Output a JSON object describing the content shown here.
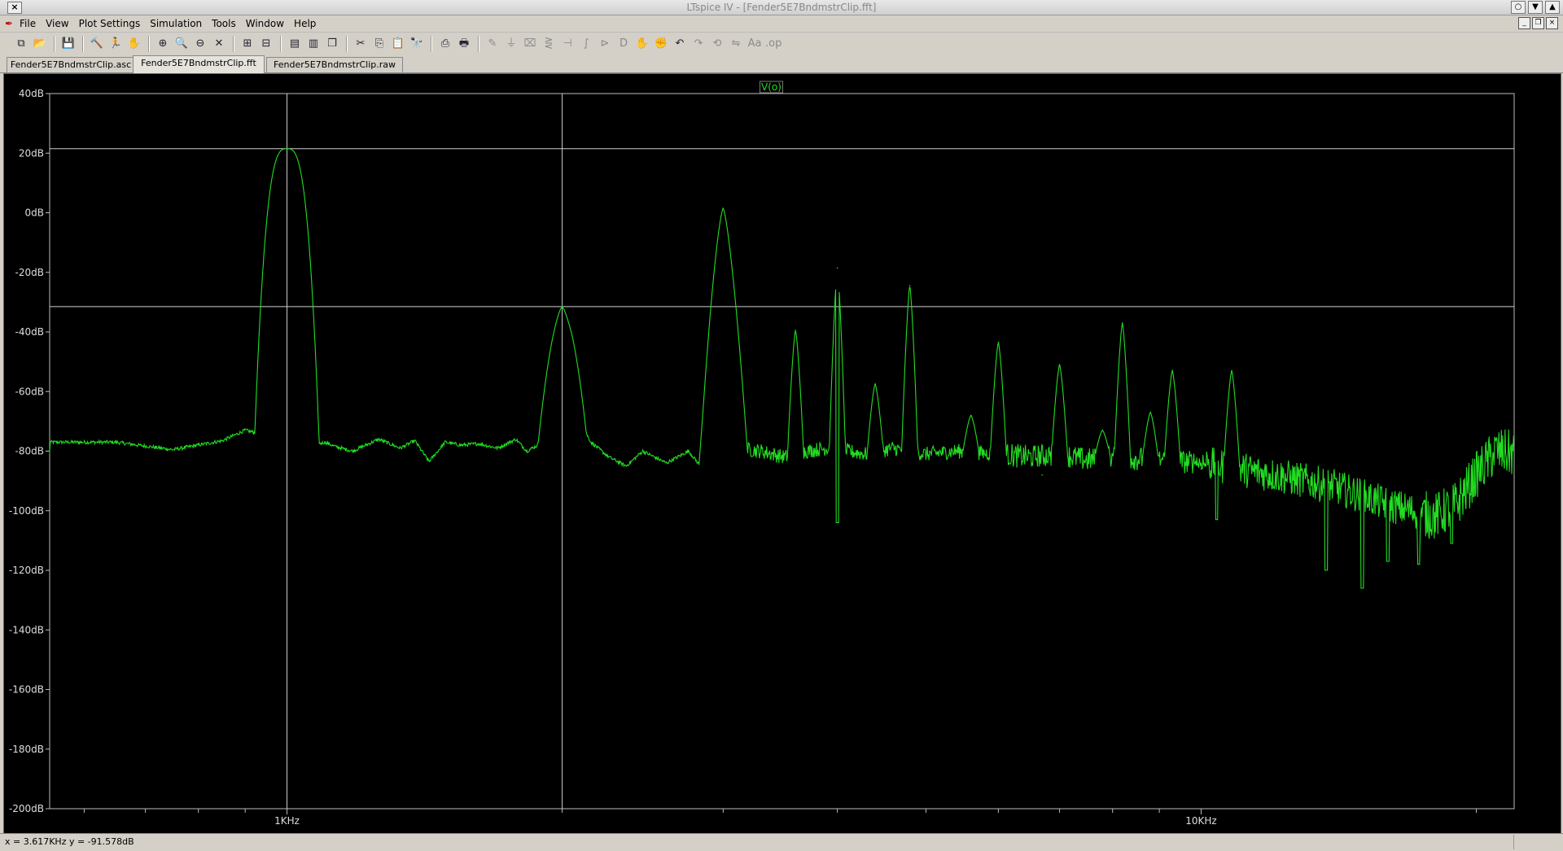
{
  "window": {
    "title": "LTspice IV - [Fender5E7BndmstrClip.fft]"
  },
  "menu": [
    "File",
    "View",
    "Plot Settings",
    "Simulation",
    "Tools",
    "Window",
    "Help"
  ],
  "toolbar": [
    {
      "name": "new-schematic",
      "glyph": "⧉"
    },
    {
      "name": "open",
      "glyph": "📂"
    },
    {
      "sep": true
    },
    {
      "name": "save",
      "glyph": "💾"
    },
    {
      "sep": true
    },
    {
      "name": "control-panel",
      "glyph": "🔨"
    },
    {
      "name": "run",
      "glyph": "🏃"
    },
    {
      "name": "pan",
      "glyph": "✋"
    },
    {
      "sep": true
    },
    {
      "name": "zoom-in",
      "glyph": "⊕"
    },
    {
      "name": "zoom-area",
      "glyph": "🔍"
    },
    {
      "name": "zoom-out",
      "glyph": "⊖"
    },
    {
      "name": "zoom-fit",
      "glyph": "✕"
    },
    {
      "sep": true
    },
    {
      "name": "autorange",
      "glyph": "⊞"
    },
    {
      "name": "autorange-y",
      "glyph": "⊟"
    },
    {
      "sep": true
    },
    {
      "name": "tile-horizontal",
      "glyph": "▤"
    },
    {
      "name": "tile-vertical",
      "glyph": "▥"
    },
    {
      "name": "cascade",
      "glyph": "❐"
    },
    {
      "sep": true
    },
    {
      "name": "cut",
      "glyph": "✂"
    },
    {
      "name": "copy",
      "glyph": "⎘"
    },
    {
      "name": "paste",
      "glyph": "📋"
    },
    {
      "name": "find",
      "glyph": "🔭"
    },
    {
      "sep": true
    },
    {
      "name": "print-preview",
      "glyph": "⎙"
    },
    {
      "name": "print",
      "glyph": "🖶"
    },
    {
      "sep": true
    },
    {
      "name": "draw-wire",
      "glyph": "✎",
      "dim": true
    },
    {
      "name": "ground",
      "glyph": "⏚",
      "dim": true
    },
    {
      "name": "label-net",
      "glyph": "⌧",
      "dim": true
    },
    {
      "name": "resistor",
      "glyph": "⋛",
      "dim": true
    },
    {
      "name": "capacitor",
      "glyph": "⊣",
      "dim": true
    },
    {
      "name": "inductor",
      "glyph": "∫",
      "dim": true
    },
    {
      "name": "diode",
      "glyph": "⊳",
      "dim": true
    },
    {
      "name": "component",
      "glyph": "D",
      "dim": true
    },
    {
      "name": "move",
      "glyph": "✋",
      "dim": true
    },
    {
      "name": "drag",
      "glyph": "✊",
      "dim": true
    },
    {
      "name": "undo",
      "glyph": "↶"
    },
    {
      "name": "redo",
      "glyph": "↷",
      "dim": true
    },
    {
      "name": "rotate",
      "glyph": "⟲",
      "dim": true
    },
    {
      "name": "mirror",
      "glyph": "⇋",
      "dim": true
    },
    {
      "name": "text",
      "glyph": "Aa",
      "dim": true
    },
    {
      "name": "spice-directive",
      "glyph": ".op",
      "dim": true
    }
  ],
  "tabs": [
    {
      "label": "Fender5E7BndmstrClip.asc",
      "active": false
    },
    {
      "label": "Fender5E7BndmstrClip.fft",
      "active": true
    },
    {
      "label": "Fender5E7BndmstrClip.raw",
      "active": false
    }
  ],
  "chart_data": {
    "type": "line",
    "trace_label": "V(o)",
    "trace_color": "#22dd22",
    "x_scale": "log",
    "x_range_hz": [
      550,
      22000
    ],
    "x_tick_labels": [
      {
        "value": 1000,
        "label": "1KHz"
      },
      {
        "value": 10000,
        "label": "10KHz"
      }
    ],
    "ylim": [
      -200,
      40
    ],
    "y_tick_labels": [
      "40dB",
      "20dB",
      "0dB",
      "-20dB",
      "-40dB",
      "-60dB",
      "-80dB",
      "-100dB",
      "-120dB",
      "-140dB",
      "-160dB",
      "-180dB",
      "-200dB"
    ],
    "cursors": [
      {
        "x": 1000,
        "y": 21.5
      },
      {
        "x": 2000,
        "y": -31.5
      }
    ],
    "baseline": [
      [
        550,
        -77
      ],
      [
        650,
        -77
      ],
      [
        750,
        -79.5
      ],
      [
        850,
        -76.5
      ],
      [
        900,
        -73
      ],
      [
        960,
        -75
      ],
      [
        1030,
        -79.5
      ],
      [
        1100,
        -77
      ],
      [
        1130,
        -78.5
      ],
      [
        1180,
        -80
      ],
      [
        1260,
        -76
      ],
      [
        1330,
        -79
      ],
      [
        1380,
        -76.5
      ],
      [
        1430,
        -83.5
      ],
      [
        1490,
        -77
      ],
      [
        1550,
        -78
      ],
      [
        1620,
        -77.5
      ],
      [
        1700,
        -79
      ],
      [
        1780,
        -76
      ],
      [
        1830,
        -80
      ],
      [
        1880,
        -78
      ],
      [
        1950,
        -70
      ],
      [
        2050,
        -65
      ],
      [
        2150,
        -77
      ],
      [
        2250,
        -82
      ],
      [
        2350,
        -85
      ],
      [
        2450,
        -80
      ],
      [
        2600,
        -84
      ],
      [
        2750,
        -80
      ],
      [
        2850,
        -86
      ],
      [
        2950,
        -82
      ],
      [
        3100,
        -79
      ],
      [
        3300,
        -80
      ],
      [
        3500,
        -82
      ],
      [
        3700,
        -80
      ],
      [
        3900,
        -79
      ],
      [
        4100,
        -80
      ],
      [
        4300,
        -81
      ],
      [
        4600,
        -79
      ],
      [
        5000,
        -81
      ],
      [
        5400,
        -80
      ],
      [
        6000,
        -81
      ],
      [
        6500,
        -82
      ],
      [
        7000,
        -81
      ],
      [
        7500,
        -83
      ],
      [
        8000,
        -82
      ],
      [
        9000,
        -83
      ],
      [
        10000,
        -84
      ],
      [
        11000,
        -86
      ],
      [
        12000,
        -88
      ],
      [
        13000,
        -90
      ],
      [
        14000,
        -92
      ],
      [
        15000,
        -95
      ],
      [
        16000,
        -98
      ],
      [
        17000,
        -100
      ],
      [
        18000,
        -102
      ],
      [
        19000,
        -98
      ],
      [
        20000,
        -88
      ],
      [
        21000,
        -80
      ],
      [
        22000,
        -81
      ]
    ],
    "peaks": [
      {
        "x": 1000,
        "y": 21.5
      },
      {
        "x": 2000,
        "y": -31.5
      },
      {
        "x": 3000,
        "y": 1.5
      },
      {
        "x": 3600,
        "y": -39.5
      },
      {
        "x": 4000,
        "y": -18.5
      },
      {
        "x": 4400,
        "y": -57.5
      },
      {
        "x": 4800,
        "y": -24.5
      },
      {
        "x": 5600,
        "y": -68
      },
      {
        "x": 6000,
        "y": -43.5
      },
      {
        "x": 6700,
        "y": -88
      },
      {
        "x": 7000,
        "y": -51
      },
      {
        "x": 7800,
        "y": -73
      },
      {
        "x": 8200,
        "y": -37
      },
      {
        "x": 8800,
        "y": -67
      },
      {
        "x": 9300,
        "y": -53
      },
      {
        "x": 10000,
        "y": -86
      },
      {
        "x": 10800,
        "y": -53
      }
    ],
    "dips": [
      {
        "x": 4000,
        "y": -104
      },
      {
        "x": 10400,
        "y": -103
      },
      {
        "x": 13700,
        "y": -120
      },
      {
        "x": 15000,
        "y": -126
      },
      {
        "x": 16000,
        "y": -117
      },
      {
        "x": 17300,
        "y": -118
      },
      {
        "x": 18800,
        "y": -111
      }
    ]
  },
  "status": {
    "cursor_readout": "x = 3.617KHz    y = -91.578dB"
  }
}
